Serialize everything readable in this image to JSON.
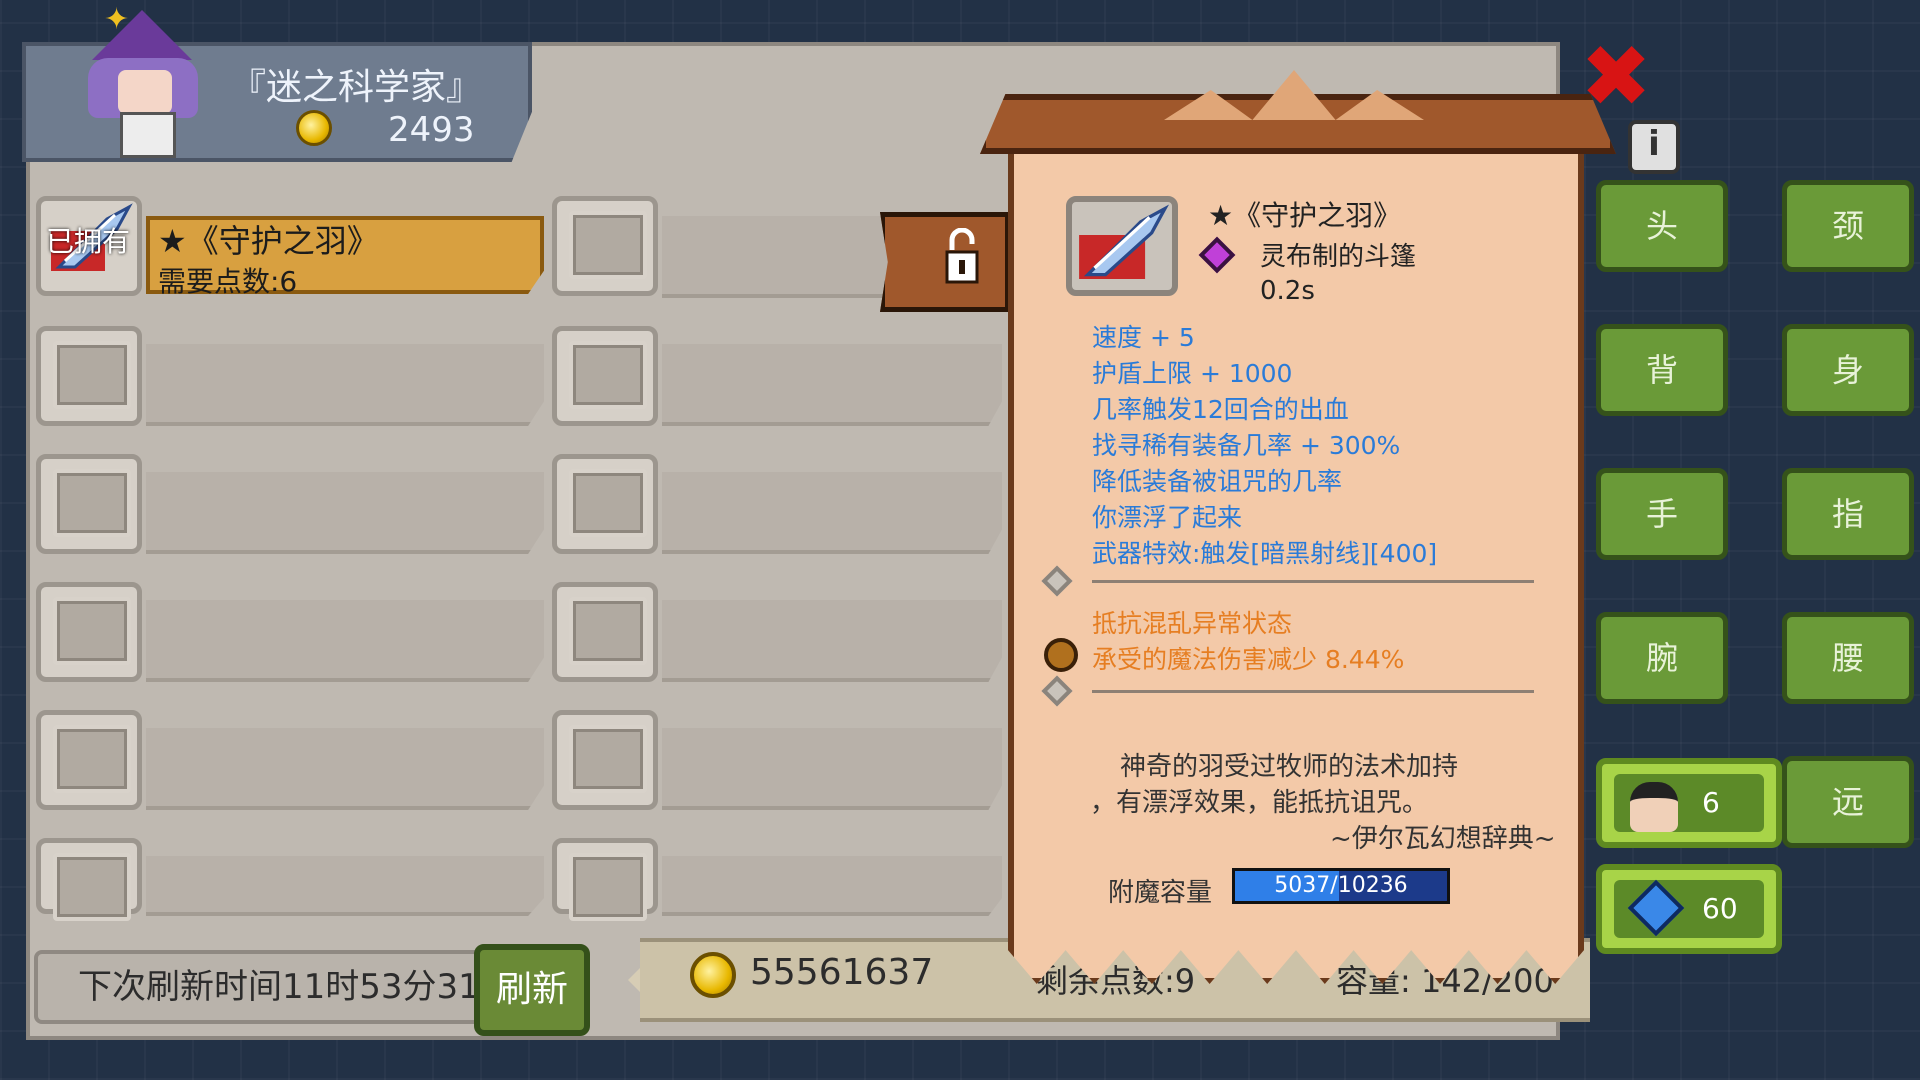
{
  "merchant": {
    "name": "『迷之科学家』",
    "coins": "2493"
  },
  "selected_item": {
    "owned_badge": "已拥有",
    "title": "★《守护之羽》",
    "cost": "需要点数:6"
  },
  "footer": {
    "refresh_time": "下次刷新时间11时53分31",
    "refresh_button": "刷新",
    "gold": "55561637",
    "points_left": "剩余点数:9",
    "capacity": "容量: 142/200"
  },
  "tooltip": {
    "name": "★《守护之羽》",
    "type": "灵布制的斗篷",
    "time": "0.2s",
    "stats": [
      "速度 + 5",
      "护盾上限 + 1000",
      "几率触发12回合的出血",
      "找寻稀有装备几率 + 300%",
      "降低装备被诅咒的几率",
      "你漂浮了起来",
      "武器特效:触发[暗黑射线][400]"
    ],
    "enchants": [
      "抵抗混乱异常状态",
      "承受的魔法伤害减少 8.44%"
    ],
    "description": [
      "神奇的羽受过牧师的法术加持",
      "，有漂浮效果，能抵抗诅咒。",
      "~伊尔瓦幻想辞典~"
    ],
    "enchant_label": "附魔容量",
    "enchant_value": "5037/10236",
    "enchant_ratio": 0.492
  },
  "equip_slots": [
    "头",
    "颈",
    "背",
    "身",
    "手",
    "指",
    "腕",
    "腰",
    "远"
  ],
  "resources": {
    "characters": "6",
    "gems": "60"
  },
  "colors": {
    "stat_text": "#2a7bd8",
    "enchant_text": "#e67e22",
    "close": "#d81414",
    "green_button": "#6a9a38"
  }
}
